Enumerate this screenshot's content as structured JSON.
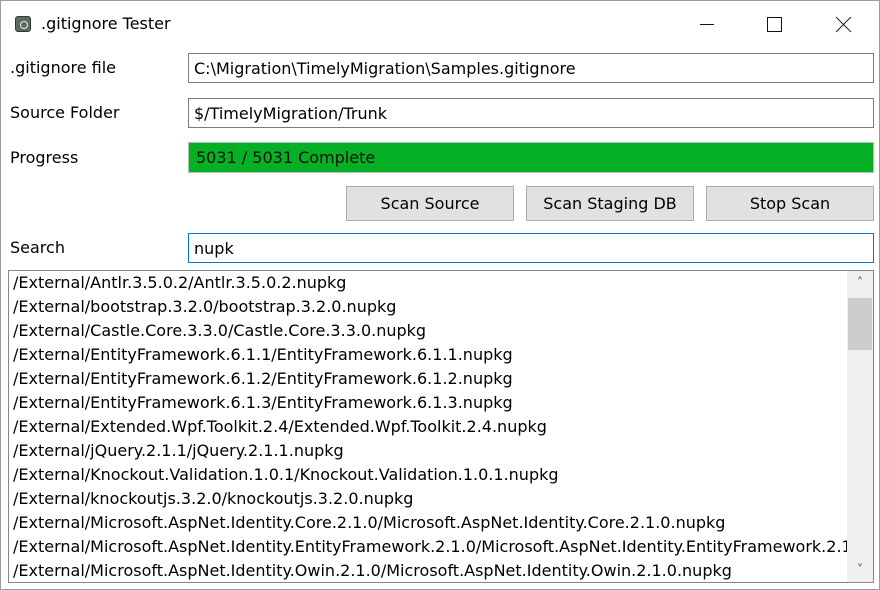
{
  "window": {
    "title": ".gitignore Tester",
    "icon": "gear-app-icon",
    "controls": {
      "minimize": "minimize-icon",
      "maximize": "maximize-icon",
      "close": "close-icon"
    }
  },
  "form": {
    "gitignore_label": ".gitignore file",
    "gitignore_value": "C:\\Migration\\TimelyMigration\\Samples.gitignore",
    "source_label": "Source Folder",
    "source_value": "$/TimelyMigration/Trunk",
    "progress_label": "Progress",
    "progress_text": "5031 / 5031 Complete",
    "progress_fraction": 1.0,
    "progress_color": "#06b025",
    "search_label": "Search",
    "search_value": "nupk"
  },
  "buttons": {
    "scan_source": "Scan Source",
    "scan_staging": "Scan Staging DB",
    "stop_scan": "Stop Scan"
  },
  "results": [
    "/External/Antlr.3.5.0.2/Antlr.3.5.0.2.nupkg",
    "/External/bootstrap.3.2.0/bootstrap.3.2.0.nupkg",
    "/External/Castle.Core.3.3.0/Castle.Core.3.3.0.nupkg",
    "/External/EntityFramework.6.1.1/EntityFramework.6.1.1.nupkg",
    "/External/EntityFramework.6.1.2/EntityFramework.6.1.2.nupkg",
    "/External/EntityFramework.6.1.3/EntityFramework.6.1.3.nupkg",
    "/External/Extended.Wpf.Toolkit.2.4/Extended.Wpf.Toolkit.2.4.nupkg",
    "/External/jQuery.2.1.1/jQuery.2.1.1.nupkg",
    "/External/Knockout.Validation.1.0.1/Knockout.Validation.1.0.1.nupkg",
    "/External/knockoutjs.3.2.0/knockoutjs.3.2.0.nupkg",
    "/External/Microsoft.AspNet.Identity.Core.2.1.0/Microsoft.AspNet.Identity.Core.2.1.0.nupkg",
    "/External/Microsoft.AspNet.Identity.EntityFramework.2.1.0/Microsoft.AspNet.Identity.EntityFramework.2.1.",
    "/External/Microsoft.AspNet.Identity.Owin.2.1.0/Microsoft.AspNet.Identity.Owin.2.1.0.nupkg"
  ]
}
